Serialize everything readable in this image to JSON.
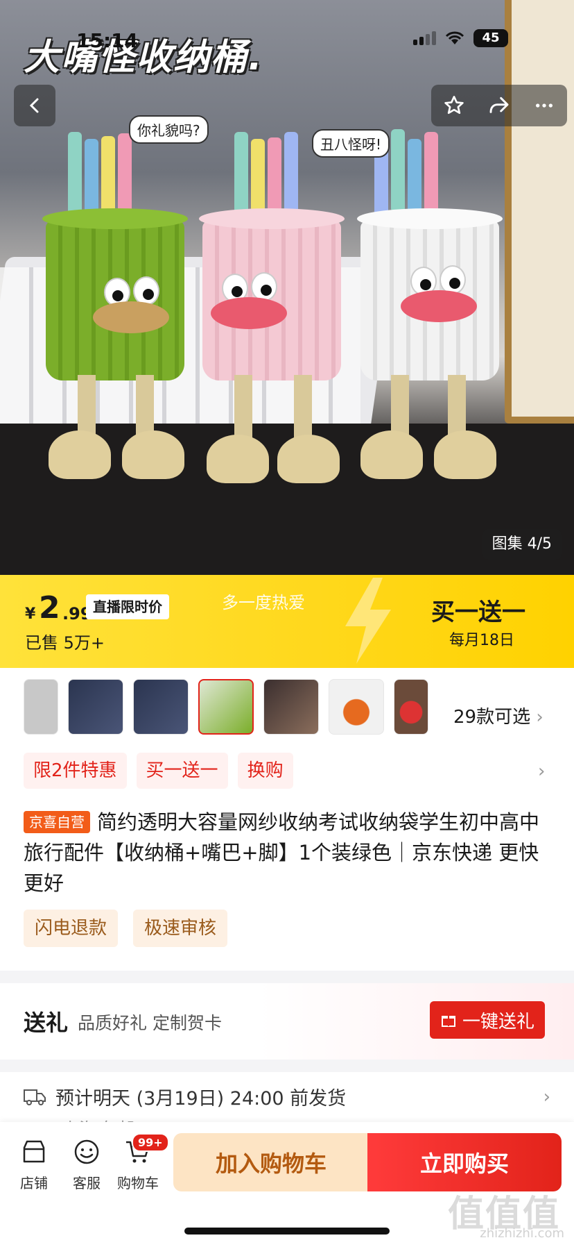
{
  "status_bar": {
    "time": "15:14",
    "battery": "45"
  },
  "hero": {
    "title": "大嘴怪收纳桶.",
    "bubble_left": "你礼貌吗?",
    "bubble_right": "丑八怪呀!",
    "gallery_label": "图集",
    "gallery_index": "4/5"
  },
  "price_banner": {
    "currency": "¥",
    "price_int": "2",
    "price_dec": ".99",
    "live_tag": "直播限时价",
    "sold": "已售 5万+",
    "slogan": "多一度热爱",
    "promo_title": "买一送一",
    "promo_sub": "每月18日"
  },
  "variants": {
    "count_label": "29款可选",
    "selected_index": 3,
    "total_thumbs": 7
  },
  "promo_chips": [
    "限2件特惠",
    "买一送一",
    "换购"
  ],
  "product": {
    "badge": "京喜自营",
    "title": "简约透明大容量网纱收纳考试收纳袋学生初中高中旅行配件【收纳桶+嘴巴+脚】1个装绿色｜京东快递 更快更好"
  },
  "services": [
    "闪电退款",
    "极速审核"
  ],
  "gift": {
    "title": "送礼",
    "subtitle": "品质好礼 定制贺卡",
    "button": "一键送礼"
  },
  "shipping": {
    "text": "预计明天 (3月19日) 24:00 前发货",
    "sub": "上海 包邮"
  },
  "bottom_bar": {
    "store": "店铺",
    "service": "客服",
    "cart": "购物车",
    "cart_badge": "99+",
    "add_to_cart": "加入购物车",
    "buy_now": "立即购买"
  },
  "watermark": {
    "main": "值值值",
    "sub": "zhizhizhi.com"
  },
  "colors": {
    "brand_red": "#e2231a",
    "banner_yellow": "#ffd81c",
    "badge_orange": "#f25c19"
  }
}
